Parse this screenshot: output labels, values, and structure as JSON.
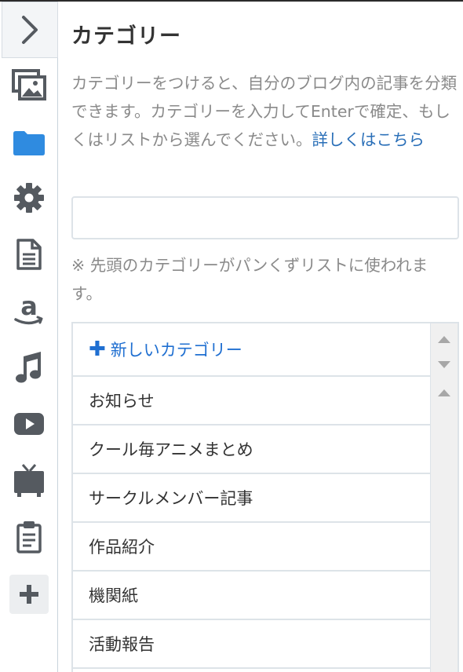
{
  "sidebar": {
    "collapse_icon": "chevron-right-icon",
    "items": [
      {
        "name": "image-icon",
        "active": false
      },
      {
        "name": "folder-icon",
        "active": true
      },
      {
        "name": "gear-icon",
        "active": false
      },
      {
        "name": "document-icon",
        "active": false
      },
      {
        "name": "amazon-icon",
        "active": false
      },
      {
        "name": "music-note-icon",
        "active": false
      },
      {
        "name": "youtube-icon",
        "active": false
      },
      {
        "name": "tv-icon",
        "active": false
      },
      {
        "name": "clipboard-icon",
        "active": false
      }
    ],
    "add_icon": "plus-icon"
  },
  "panel": {
    "title": "カテゴリー",
    "description": "カテゴリーをつけると、自分のブログ内の記事を分類できます。カテゴリーを入力してEnterで確定、もしくはリストから選んでください。",
    "help_link": "詳しくはこちら",
    "input_value": "",
    "note": "※ 先頭のカテゴリーがパンくずリストに使われます。"
  },
  "category_list": {
    "new_category_label": "新しいカテゴリー",
    "items": [
      "お知らせ",
      "クール毎アニメまとめ",
      "サークルメンバー記事",
      "作品紹介",
      "機関紙",
      "活動報告"
    ]
  },
  "colors": {
    "accent_blue": "#1f6fd1",
    "link_blue": "#2a6fb8",
    "folder_blue": "#2f8be0",
    "icon_gray": "#555a60"
  }
}
